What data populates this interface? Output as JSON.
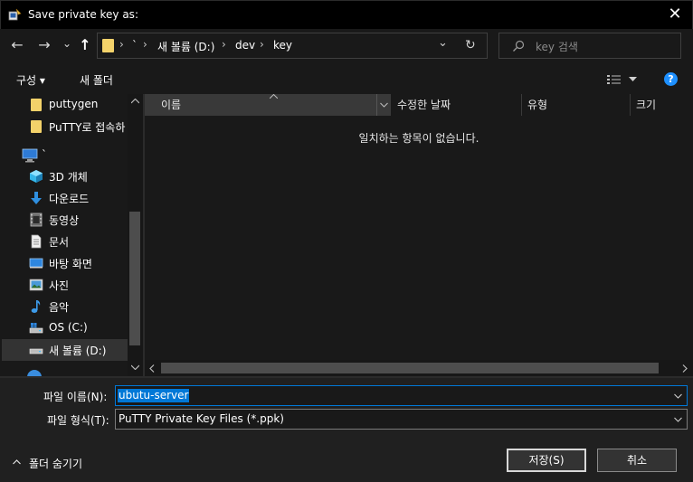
{
  "window": {
    "title": "Save private key as:",
    "close_glyph": "✕"
  },
  "nav": {
    "back_glyph": "←",
    "forward_glyph": "→",
    "recent_glyph": "⌄",
    "up_glyph": "↑",
    "breadcrumb": [
      "`",
      "새 볼륨 (D:)",
      "dev",
      "key"
    ],
    "crumb_sep": "›",
    "dropdown_glyph": "⌄",
    "refresh_glyph": "↻",
    "search_placeholder": "key 검색"
  },
  "toolbar": {
    "organize_label": "구성 ▾",
    "new_folder_label": "새 폴더",
    "help_glyph": "?"
  },
  "sidebar": {
    "items": [
      {
        "label": "puttygen",
        "icon": "folder-icon"
      },
      {
        "label": "PuTTY로 접속하",
        "icon": "folder-icon"
      },
      {
        "label": "`",
        "icon": "computer-icon"
      },
      {
        "label": "3D 개체",
        "icon": "3d-objects-icon"
      },
      {
        "label": "다운로드",
        "icon": "download-icon"
      },
      {
        "label": "동영상",
        "icon": "video-icon"
      },
      {
        "label": "문서",
        "icon": "document-icon"
      },
      {
        "label": "바탕 화면",
        "icon": "desktop-icon"
      },
      {
        "label": "사진",
        "icon": "pictures-icon"
      },
      {
        "label": "음악",
        "icon": "music-icon"
      },
      {
        "label": "OS (C:)",
        "icon": "drive-icon"
      },
      {
        "label": "새 볼륨 (D:)",
        "icon": "drive-icon"
      }
    ]
  },
  "filelist": {
    "columns": [
      "이름",
      "수정한 날짜",
      "유형",
      "크기"
    ],
    "empty_message": "일치하는 항목이 없습니다."
  },
  "form": {
    "filename_label": "파일 이름(N):",
    "filename_value": "ubutu-server",
    "filetype_label": "파일 형식(T):",
    "filetype_value": "PuTTY Private Key Files (*.ppk)",
    "hide_folders_label": "폴더 숨기기",
    "save_label": "저장(S)",
    "cancel_label": "취소"
  },
  "colors": {
    "background": "#191919",
    "titlebar": "#000000",
    "accent": "#0078d7",
    "folder": "#f3d26a",
    "help": "#1e90ff"
  }
}
